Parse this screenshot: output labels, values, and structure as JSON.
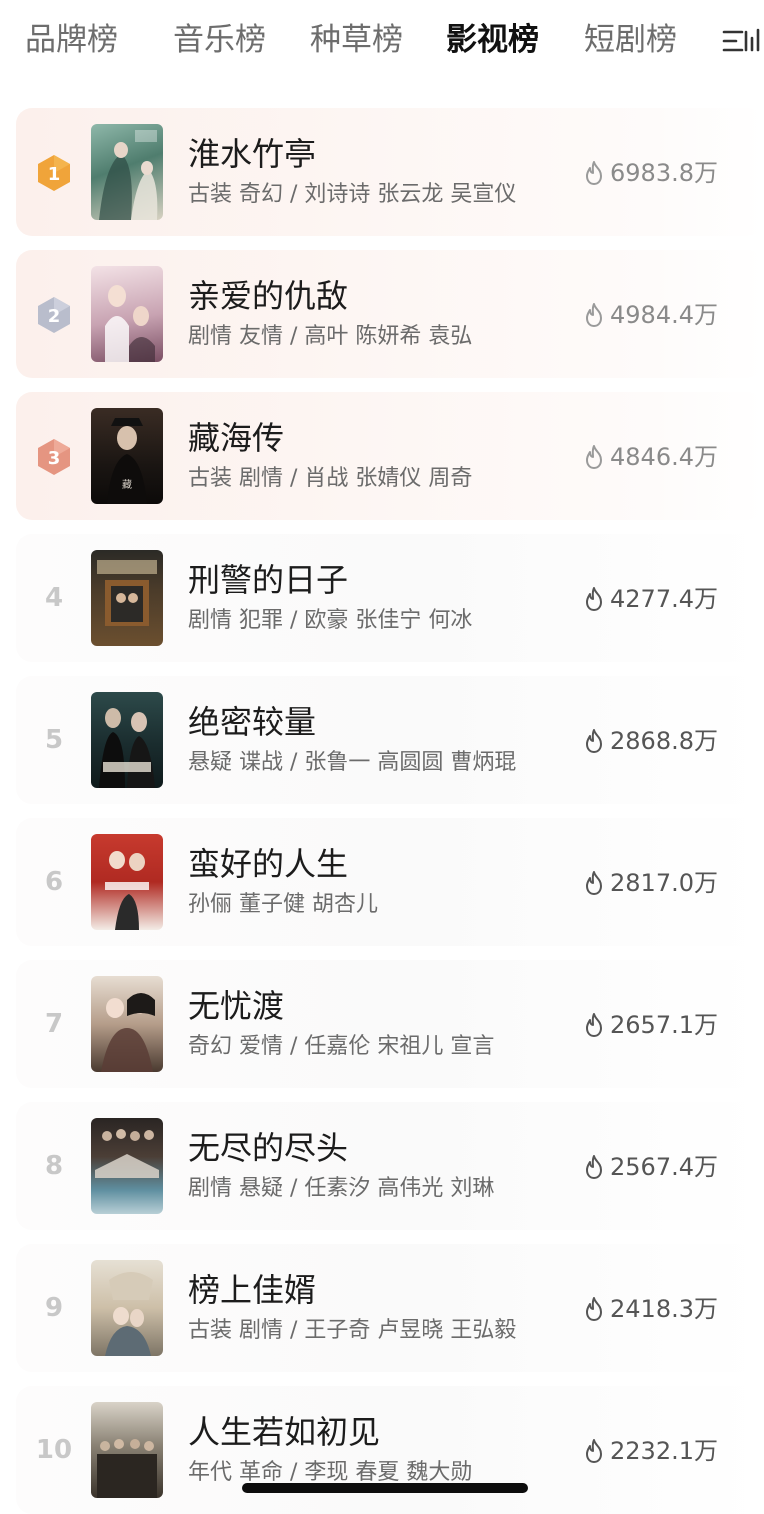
{
  "tabs": [
    {
      "label": "品牌榜",
      "active": false
    },
    {
      "label": "音乐榜",
      "active": false
    },
    {
      "label": "种草榜",
      "active": false
    },
    {
      "label": "影视榜",
      "active": true
    },
    {
      "label": "短剧榜",
      "active": false
    }
  ],
  "filter_icon": "filter-icon",
  "ranking": [
    {
      "rank": "1",
      "title": "淮水竹亭",
      "meta": "古装 奇幻 / 刘诗诗 张云龙 吴宣仪",
      "heat": "6983.8万",
      "badge_color": "#f0a43a"
    },
    {
      "rank": "2",
      "title": "亲爱的仇敌",
      "meta": "剧情 友情 / 高叶 陈妍希 袁弘",
      "heat": "4984.4万",
      "badge_color": "#b9bdcc"
    },
    {
      "rank": "3",
      "title": "藏海传",
      "meta": "古装 剧情 / 肖战 张婧仪 周奇",
      "heat": "4846.4万",
      "badge_color": "#e59581"
    },
    {
      "rank": "4",
      "title": "刑警的日子",
      "meta": "剧情 犯罪 / 欧豪 张佳宁 何冰",
      "heat": "4277.4万"
    },
    {
      "rank": "5",
      "title": "绝密较量",
      "meta": "悬疑 谍战 / 张鲁一 高圆圆 曹炳琨",
      "heat": "2868.8万"
    },
    {
      "rank": "6",
      "title": "蛮好的人生",
      "meta": "孙俪 董子健 胡杏儿",
      "heat": "2817.0万"
    },
    {
      "rank": "7",
      "title": "无忧渡",
      "meta": "奇幻 爱情 / 任嘉伦 宋祖儿 宣言",
      "heat": "2657.1万"
    },
    {
      "rank": "8",
      "title": "无尽的尽头",
      "meta": "剧情 悬疑 / 任素汐 高伟光 刘琳",
      "heat": "2567.4万"
    },
    {
      "rank": "9",
      "title": "榜上佳婿",
      "meta": "古装 剧情 / 王子奇 卢昱晓 王弘毅",
      "heat": "2418.3万"
    },
    {
      "rank": "10",
      "title": "人生若如初见",
      "meta": "年代 革命 / 李现 春夏 魏大勋",
      "heat": "2232.1万"
    }
  ]
}
